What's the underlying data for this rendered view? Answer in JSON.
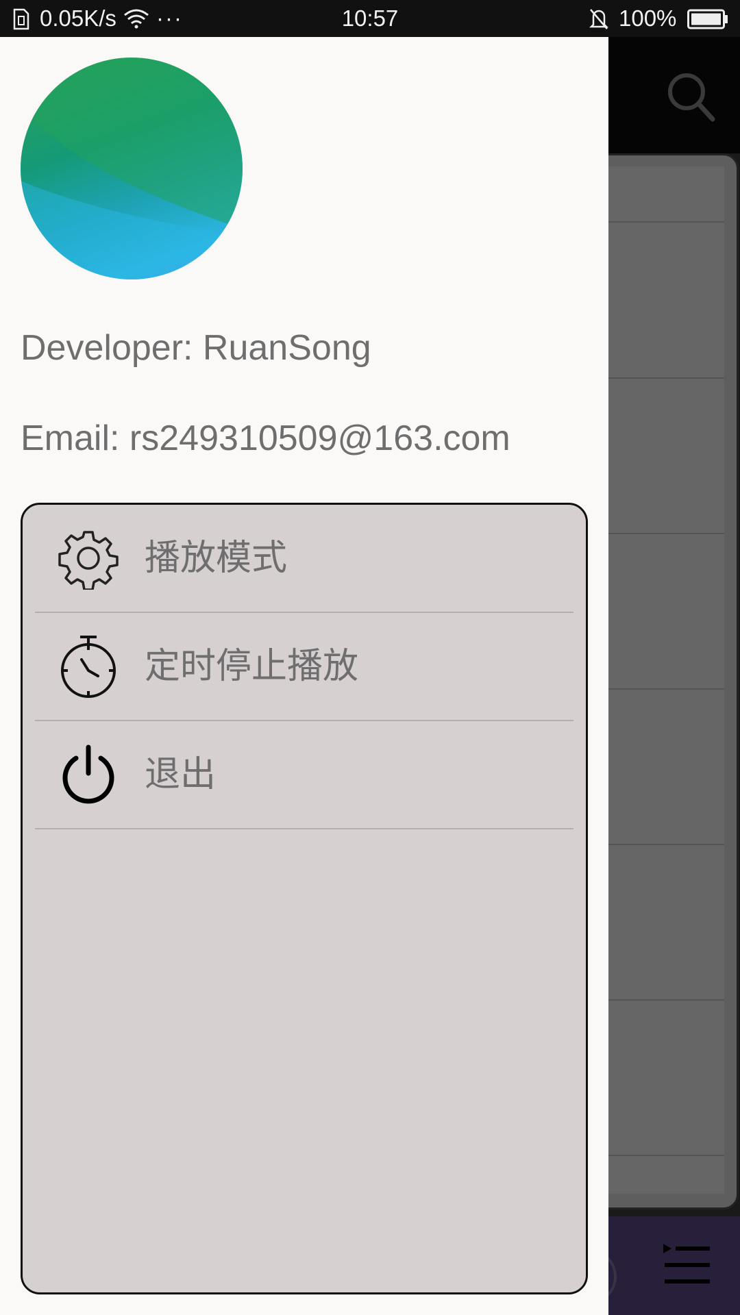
{
  "status_bar": {
    "speed": "0.05K/s",
    "more": "···",
    "time": "10:57",
    "battery": "100%"
  },
  "drawer": {
    "developer": "Developer: RuanSong",
    "email": "Email: rs249310509@163.com",
    "menu": [
      {
        "label": "播放模式",
        "icon": "gear-icon"
      },
      {
        "label": "定时停止播放",
        "icon": "stopwatch-icon"
      },
      {
        "label": "退出",
        "icon": "power-icon"
      }
    ]
  },
  "colors": {
    "drawer_bg": "#faf9f8",
    "menu_card_bg": "#d6d0d1",
    "text": "#6e6e6e",
    "bottom_bar": "#28203a"
  }
}
